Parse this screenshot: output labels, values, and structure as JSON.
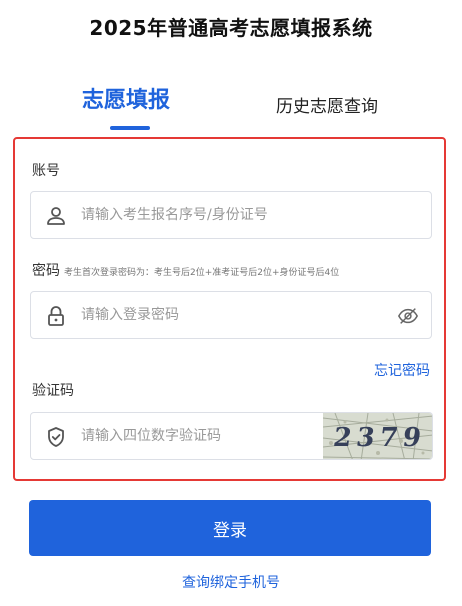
{
  "page": {
    "title": "2025年普通高考志愿填报系统"
  },
  "tabs": {
    "active_label": "志愿填报",
    "history_label": "历史志愿查询"
  },
  "form": {
    "account_label": "账号",
    "account_placeholder": "请输入考生报名序号/身份证号",
    "password_label": "密码",
    "password_hint": "考生首次登录密码为：考生号后2位+准考证号后2位+身份证号后4位",
    "password_placeholder": "请输入登录密码",
    "forgot_label": "忘记密码",
    "captcha_label": "验证码",
    "captcha_placeholder": "请输入四位数字验证码",
    "captcha_text": "2379"
  },
  "actions": {
    "login_label": "登录",
    "bind_phone_label": "查询绑定手机号"
  },
  "colors": {
    "accent": "#1f63dc",
    "highlight_border": "#e53935"
  },
  "icons": {
    "account": "user-icon",
    "password": "lock-icon",
    "visibility": "eye-off-icon",
    "captcha": "shield-check-icon"
  }
}
